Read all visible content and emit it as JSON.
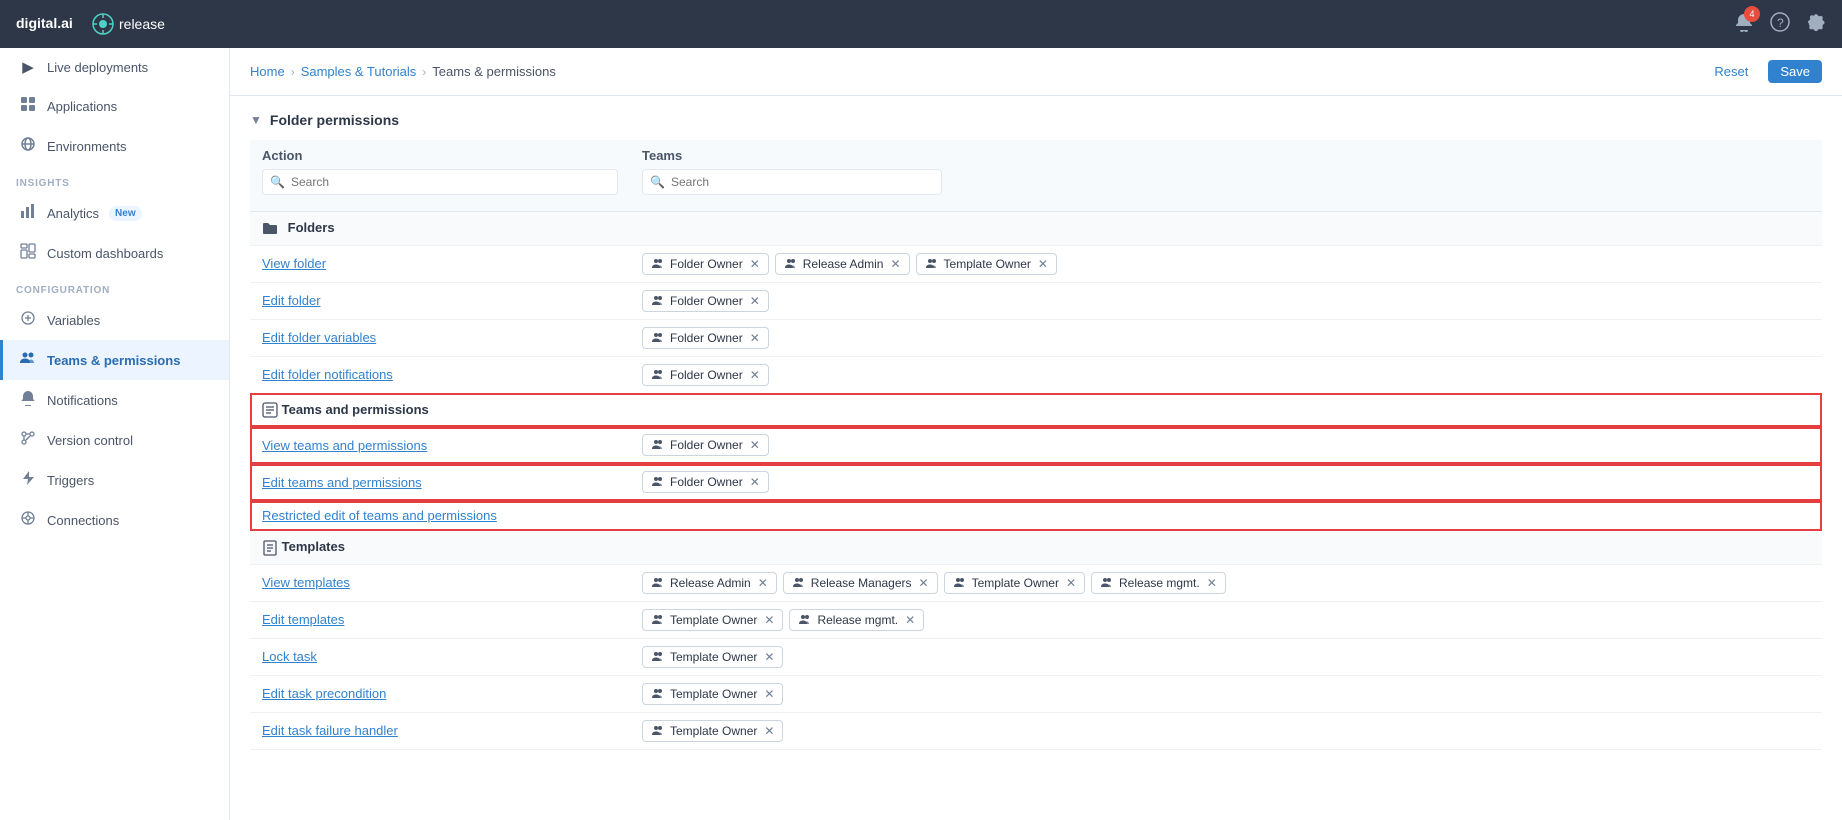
{
  "navbar": {
    "logo": "digital.ai",
    "release": "release",
    "notification_count": "4"
  },
  "breadcrumb": {
    "home": "Home",
    "samples": "Samples & Tutorials",
    "current": "Teams & permissions"
  },
  "header_actions": {
    "reset": "Reset",
    "save": "Save"
  },
  "sidebar": {
    "items": [
      {
        "id": "live-deployments",
        "label": "Live deployments",
        "icon": "▶",
        "active": false
      },
      {
        "id": "applications",
        "label": "Applications",
        "icon": "⊞",
        "active": false
      },
      {
        "id": "environments",
        "label": "Environments",
        "icon": "◈",
        "active": false
      }
    ],
    "sections": [
      {
        "label": "INSIGHTS",
        "items": [
          {
            "id": "analytics",
            "label": "Analytics",
            "icon": "▦",
            "badge": "New",
            "active": false
          },
          {
            "id": "custom-dashboards",
            "label": "Custom dashboards",
            "icon": "⊟",
            "active": false
          }
        ]
      },
      {
        "label": "CONFIGURATION",
        "items": [
          {
            "id": "variables",
            "label": "Variables",
            "icon": "⊕",
            "active": false
          },
          {
            "id": "teams-permissions",
            "label": "Teams & permissions",
            "icon": "⊞",
            "active": true
          },
          {
            "id": "notifications",
            "label": "Notifications",
            "icon": "🔔",
            "active": false
          },
          {
            "id": "version-control",
            "label": "Version control",
            "icon": "⎇",
            "active": false
          },
          {
            "id": "triggers",
            "label": "Triggers",
            "icon": "⚡",
            "active": false
          },
          {
            "id": "connections",
            "label": "Connections",
            "icon": "⊗",
            "active": false
          }
        ]
      }
    ]
  },
  "folder_permissions": {
    "title": "Folder permissions",
    "action_search_placeholder": "Search",
    "teams_search_placeholder": "Search",
    "folders_section": {
      "label": "Folders",
      "rows": [
        {
          "action": "View folder",
          "teams": [
            {
              "name": "Folder Owner",
              "removable": true
            },
            {
              "name": "Release Admin",
              "removable": true
            },
            {
              "name": "Template Owner",
              "removable": true
            }
          ]
        },
        {
          "action": "Edit folder",
          "teams": [
            {
              "name": "Folder Owner",
              "removable": true
            }
          ]
        },
        {
          "action": "Edit folder variables",
          "teams": [
            {
              "name": "Folder Owner",
              "removable": true
            }
          ]
        },
        {
          "action": "Edit folder notifications",
          "teams": [
            {
              "name": "Folder Owner",
              "removable": true
            }
          ]
        }
      ]
    },
    "teams_permissions_section": {
      "label": "Teams and permissions",
      "highlighted": true,
      "rows": [
        {
          "action": "View teams and permissions",
          "teams": [
            {
              "name": "Folder Owner",
              "removable": true
            }
          ]
        },
        {
          "action": "Edit teams and permissions",
          "teams": [
            {
              "name": "Folder Owner",
              "removable": true
            }
          ]
        },
        {
          "action": "Restricted edit of teams and permissions",
          "teams": []
        }
      ]
    },
    "templates_section": {
      "label": "Templates",
      "rows": [
        {
          "action": "View templates",
          "teams": [
            {
              "name": "Release Admin",
              "removable": true
            },
            {
              "name": "Release Managers",
              "removable": true
            },
            {
              "name": "Template Owner",
              "removable": true
            },
            {
              "name": "Release mgmt.",
              "removable": true
            }
          ]
        },
        {
          "action": "Edit templates",
          "teams": [
            {
              "name": "Template Owner",
              "removable": true
            },
            {
              "name": "Release mgmt.",
              "removable": true
            }
          ]
        },
        {
          "action": "Lock task",
          "teams": [
            {
              "name": "Template Owner",
              "removable": true
            }
          ]
        },
        {
          "action": "Edit task precondition",
          "teams": [
            {
              "name": "Template Owner",
              "removable": true
            }
          ]
        },
        {
          "action": "Edit task failure handler",
          "teams": [
            {
              "name": "Template Owner",
              "removable": true
            }
          ]
        }
      ]
    }
  }
}
